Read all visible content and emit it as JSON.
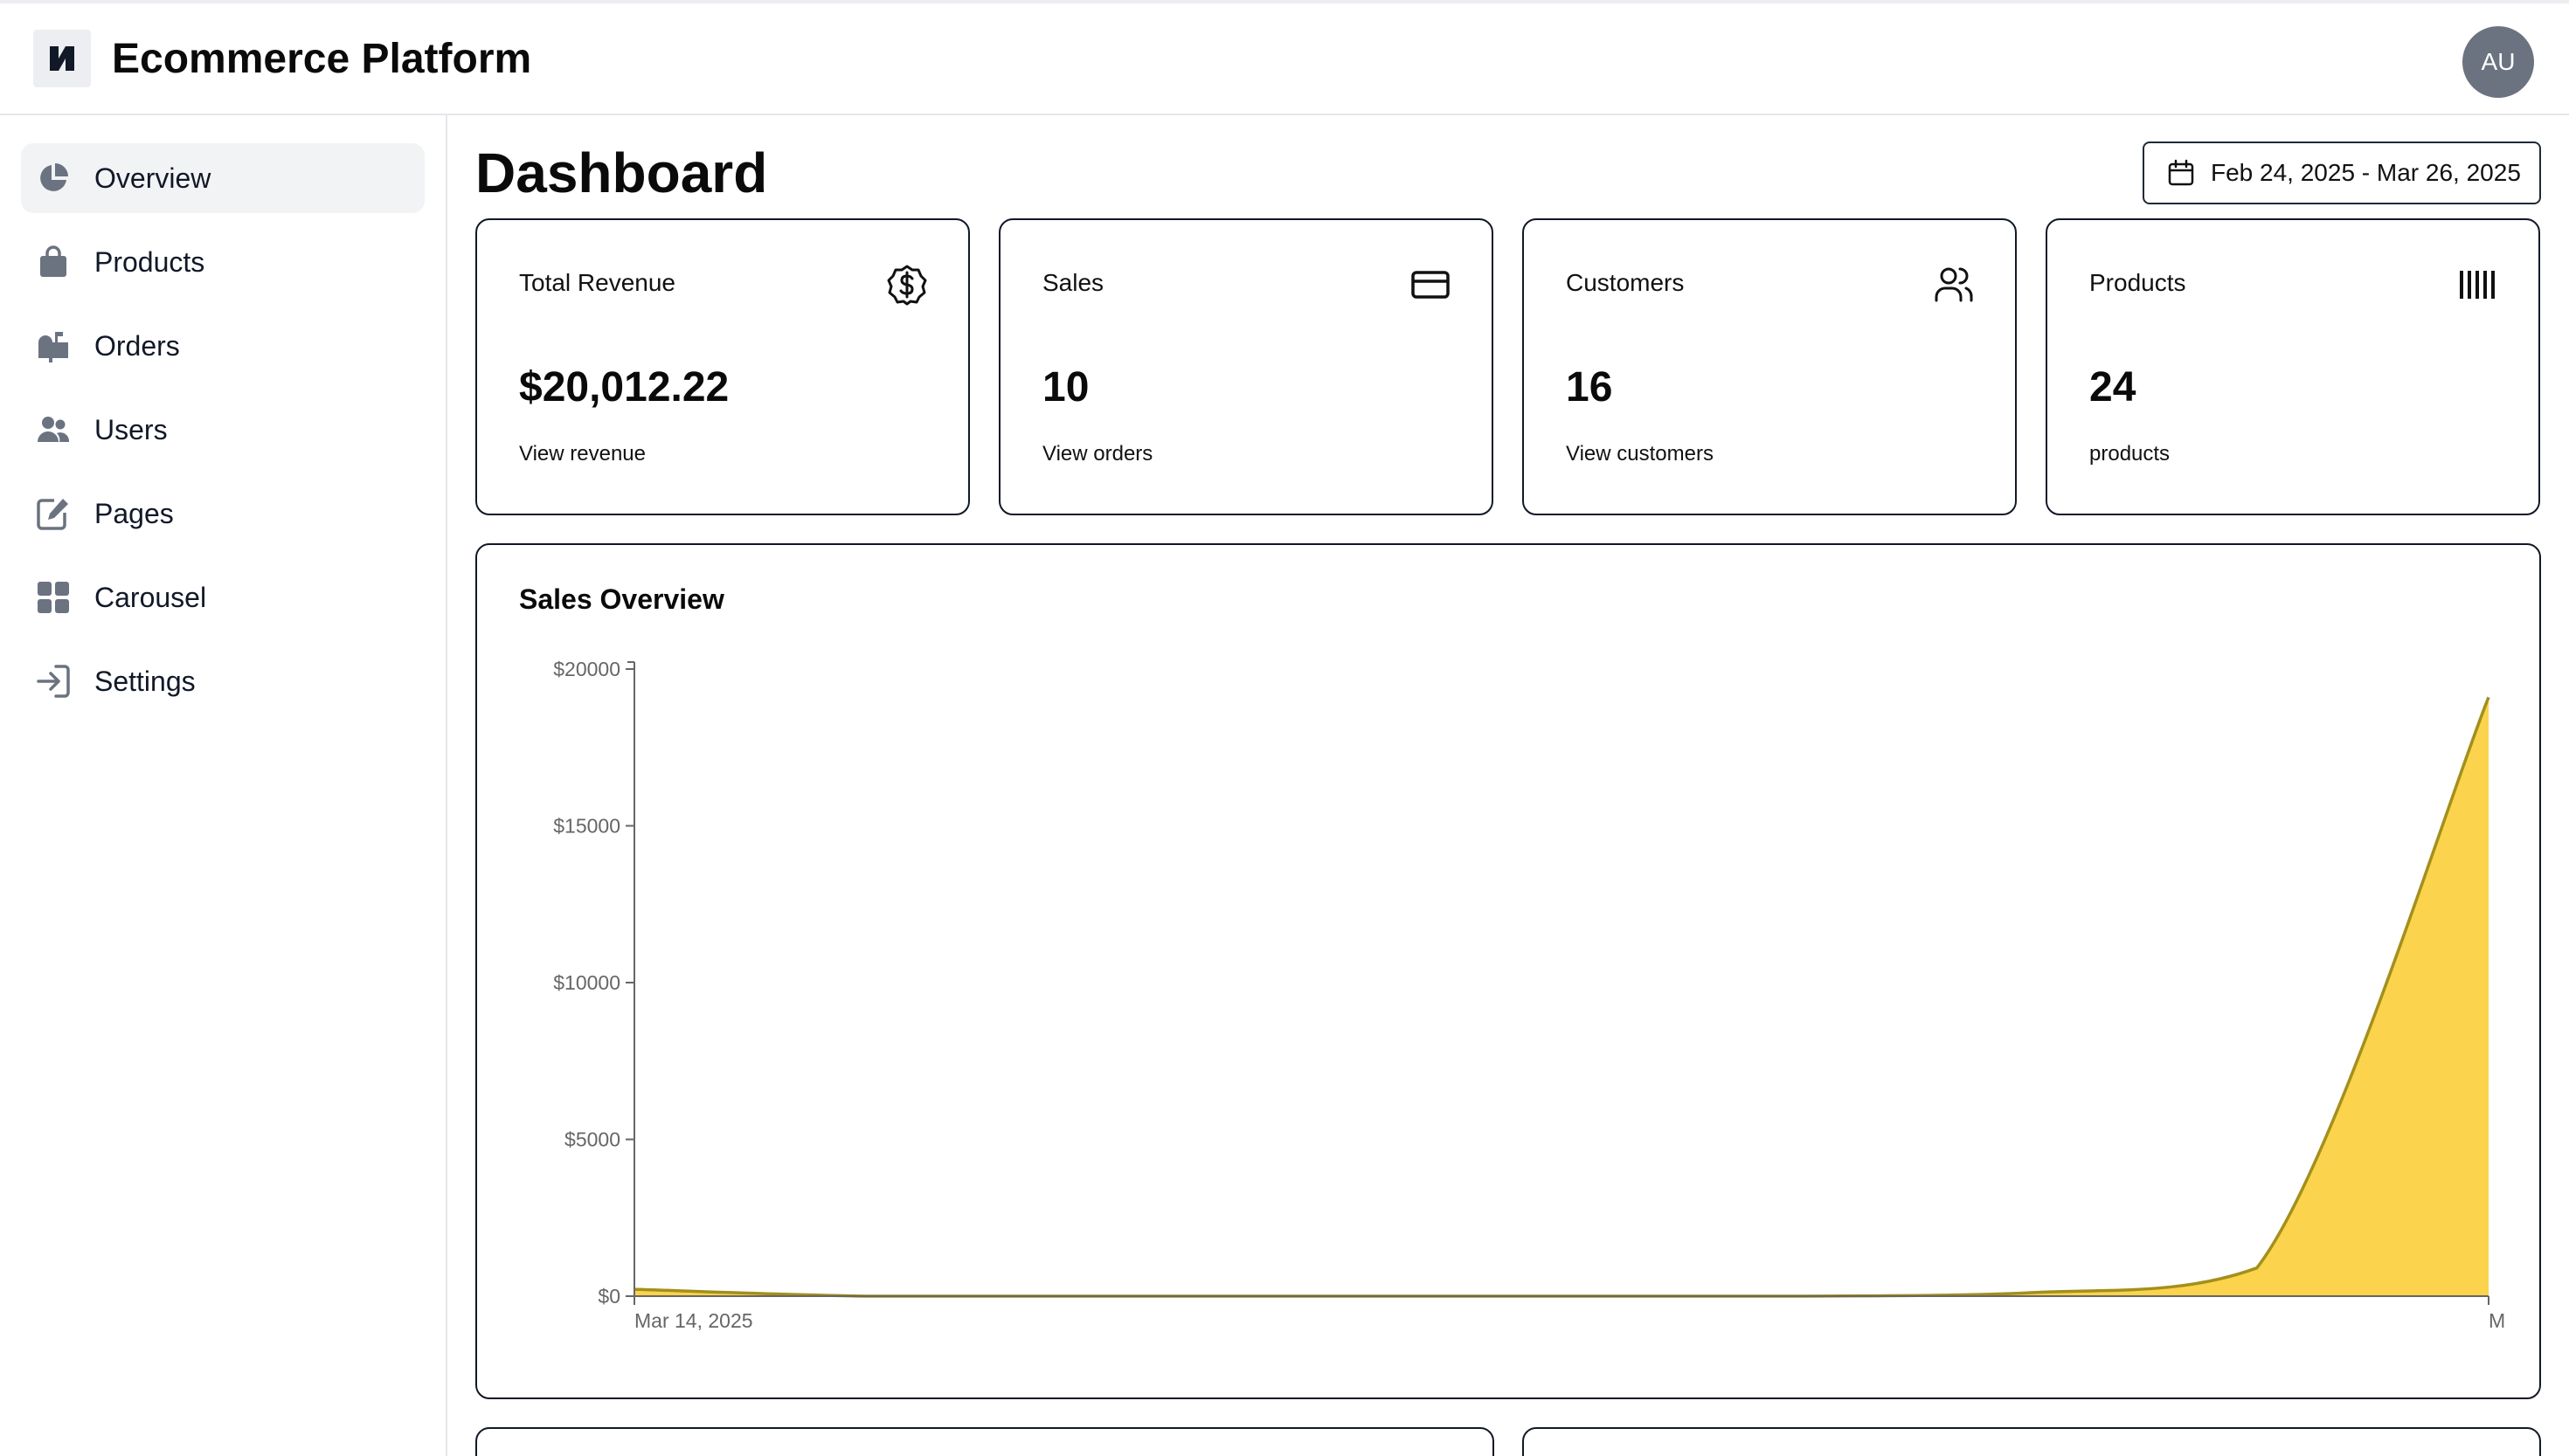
{
  "app": {
    "title": "Ecommerce Platform",
    "avatar_initials": "AU"
  },
  "sidebar": {
    "items": [
      {
        "label": "Overview",
        "icon": "pie-chart-icon",
        "active": true
      },
      {
        "label": "Products",
        "icon": "shopping-bag-icon",
        "active": false
      },
      {
        "label": "Orders",
        "icon": "mailbox-icon",
        "active": false
      },
      {
        "label": "Users",
        "icon": "users-icon",
        "active": false
      },
      {
        "label": "Pages",
        "icon": "edit-icon",
        "active": false
      },
      {
        "label": "Carousel",
        "icon": "grid-icon",
        "active": false
      },
      {
        "label": "Settings",
        "icon": "sign-in-icon",
        "active": false
      }
    ]
  },
  "main": {
    "title": "Dashboard",
    "date_range": "Feb 24, 2025 - Mar 26, 2025",
    "cards": [
      {
        "label": "Total Revenue",
        "value": "$20,012.22",
        "link": "View revenue",
        "icon": "dollar-badge-icon"
      },
      {
        "label": "Sales",
        "value": "10",
        "link": "View orders",
        "icon": "credit-card-icon"
      },
      {
        "label": "Customers",
        "value": "16",
        "link": "View customers",
        "icon": "users-outline-icon"
      },
      {
        "label": "Products",
        "value": "24",
        "link": "products",
        "icon": "barcode-icon"
      }
    ]
  },
  "chart_data": {
    "type": "area",
    "title": "Sales Overview",
    "xlabel": "",
    "ylabel": "",
    "x_tick_labels": [
      "Mar 14, 2025",
      "M"
    ],
    "y_ticks": [
      0,
      5000,
      10000,
      15000,
      20000
    ],
    "y_tick_labels": [
      "$0",
      "$5000",
      "$10000",
      "$15000",
      "$20000"
    ],
    "ylim": [
      0,
      20000
    ],
    "series": [
      {
        "values": [
          220,
          0,
          0,
          0,
          0,
          0,
          100,
          900,
          19100
        ]
      }
    ],
    "fill_color": "#fcd34d",
    "line_color": "#a3901c",
    "grid": false,
    "legend": "none"
  },
  "colors": {
    "border": "#111827",
    "muted_icon": "#6b7280",
    "active_nav_bg": "#f2f3f5"
  }
}
